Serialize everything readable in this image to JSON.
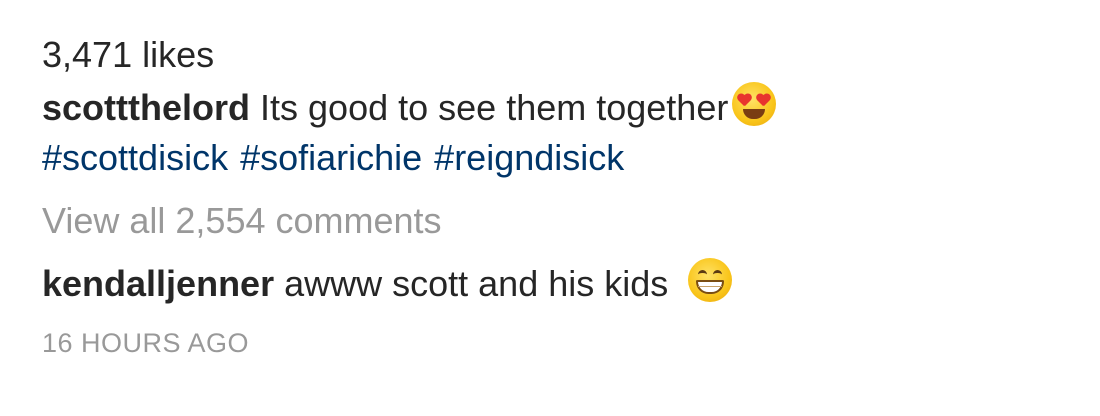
{
  "post": {
    "likes": "3,471 likes",
    "caption": {
      "username": "scottthelord",
      "text": "Its good to see them together",
      "emoji": "heart-eyes-emoji",
      "hashtags": [
        "#scottdisick",
        "#sofiarichie",
        "#reigndisick"
      ]
    },
    "view_all_comments": "View all 2,554 comments",
    "comment": {
      "username": "kendalljenner",
      "text": "awww scott and his kids",
      "emoji": "grinning-face-emoji"
    },
    "timestamp": "16 HOURS AGO"
  },
  "colors": {
    "text": "#262626",
    "hashtag": "#003569",
    "muted": "#999999"
  }
}
